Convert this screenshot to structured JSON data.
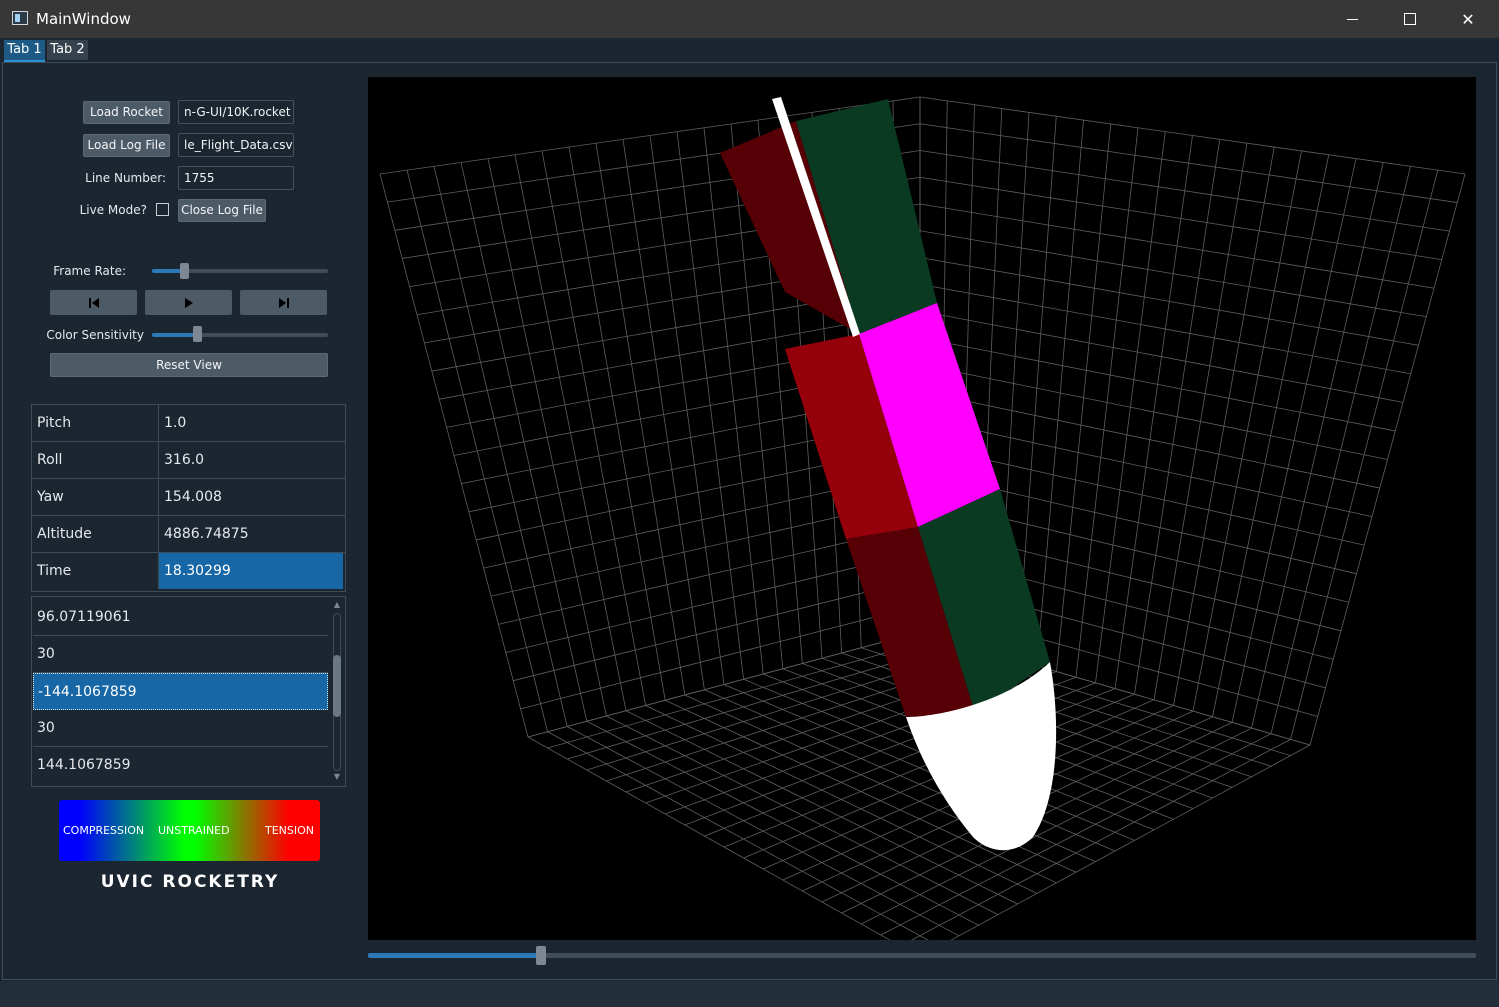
{
  "window": {
    "title": "MainWindow"
  },
  "tabs": [
    {
      "label": "Tab 1",
      "active": true
    },
    {
      "label": "Tab 2",
      "active": false
    }
  ],
  "controls": {
    "load_rocket_label": "Load Rocket",
    "rocket_path": "n-G-UI/10K.rocket",
    "load_log_label": "Load Log File",
    "log_path": "le_Flight_Data.csv",
    "line_number_label": "Line Number:",
    "line_number_value": "1755",
    "live_mode_label": "Live Mode?",
    "live_mode_checked": false,
    "close_log_label": "Close Log File",
    "frame_rate_label": "Frame Rate:",
    "frame_rate_value": 0.2,
    "color_sensitivity_label": "Color Sensitivity",
    "color_sensitivity_value": 0.26,
    "reset_view_label": "Reset View"
  },
  "playback": {
    "prev_icon": "skip-previous-icon",
    "play_icon": "play-icon",
    "next_icon": "skip-next-icon"
  },
  "telemetry": [
    {
      "key": "Pitch",
      "value": "1.0"
    },
    {
      "key": "Roll",
      "value": "316.0"
    },
    {
      "key": "Yaw",
      "value": "154.008"
    },
    {
      "key": "Altitude",
      "value": "4886.74875"
    },
    {
      "key": "Time",
      "value": "18.30299",
      "selected": true
    }
  ],
  "values_list": [
    {
      "value": "96.07119061"
    },
    {
      "value": "30"
    },
    {
      "value": "-144.1067859",
      "selected": true
    },
    {
      "value": "30"
    },
    {
      "value": "144.1067859"
    }
  ],
  "legend": {
    "compression": "COMPRESSION",
    "unstrained": "UNSTRAINED",
    "tension": "TENSION"
  },
  "logo_text": "UVIC ROCKETRY",
  "timeline": {
    "position": 0.156
  },
  "colors": {
    "accent": "#1767a6",
    "compression": "#0000ff",
    "unstrained": "#00ff00",
    "tension": "#ff0000",
    "rocket_dark_red": "#560006",
    "rocket_red": "#96000b",
    "rocket_green": "#0a3a22",
    "rocket_magenta": "#ff00ff",
    "nosecone": "#ffffff"
  }
}
